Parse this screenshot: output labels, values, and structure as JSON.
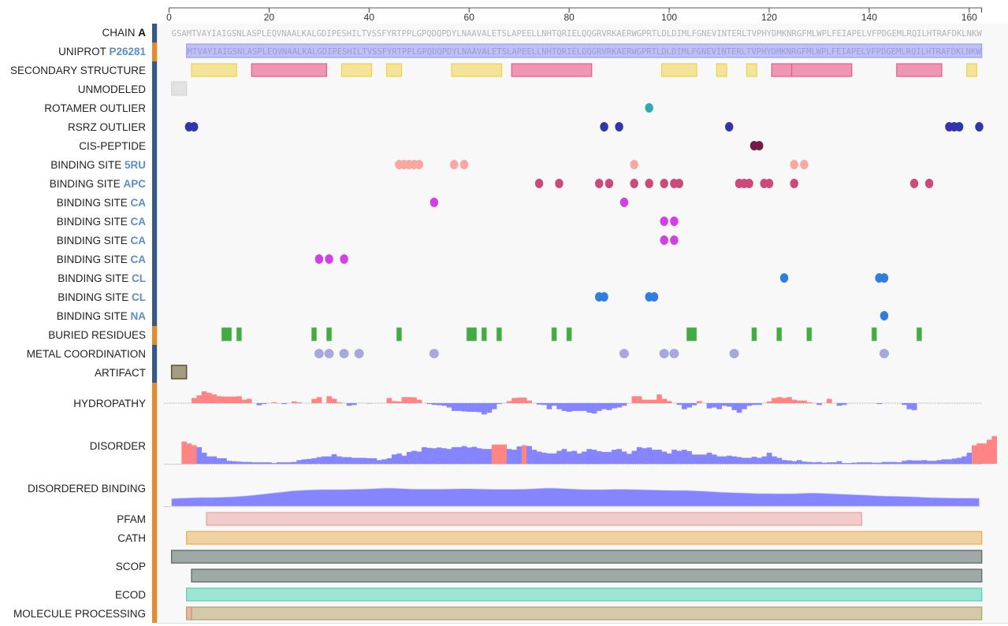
{
  "chart_data": {
    "type": "protein-feature-viewer",
    "axis": {
      "min": 0,
      "max": 162,
      "ticks": [
        0,
        20,
        40,
        60,
        80,
        100,
        120,
        140,
        160
      ]
    },
    "chain": {
      "label": "CHAIN",
      "id": "A",
      "sequence": "GSAMTVAYIAIGSNLASPLEQVNAALKALGDIPESHILTVSSFYRTPPLGPQDQPDYLNAAVALETSLAPEELLNHTQRIELQQGRVRKAERWGPRTLDLDIMLFGNEVINTERLTVPHYDMKNRGFMLWPLFEIAPELVFPDGEMLRQILHTRAFDKLNKW"
    },
    "uniprot": {
      "label": "UNIPROT",
      "id": "P26281",
      "start": 4,
      "end": 162,
      "sequence": "MTVAYIAIGSNLASPLEQVNAALKALGDIPESHILTVSSFYRTPPLGPQDQPDYLNAAVALETSLAPEELLNHTQRIELQQGRVRKAERWGPRTLDLDIMLFGNEVINTERLTVPHYDMKNRGFMLWPLFEIAPELVFPDGEMLRQILHTRAFDKLNKW"
    },
    "secondary_structure": {
      "label": "SECONDARY STRUCTURE",
      "segments": [
        {
          "type": "strand",
          "start": 5,
          "end": 13
        },
        {
          "type": "helix",
          "start": 17,
          "end": 31
        },
        {
          "type": "strand",
          "start": 35,
          "end": 40
        },
        {
          "type": "strand",
          "start": 44,
          "end": 46
        },
        {
          "type": "strand",
          "start": 57,
          "end": 66
        },
        {
          "type": "helix",
          "start": 69,
          "end": 84
        },
        {
          "type": "strand",
          "start": 99,
          "end": 105
        },
        {
          "type": "strand",
          "start": 110,
          "end": 111
        },
        {
          "type": "strand",
          "start": 116,
          "end": 117
        },
        {
          "type": "helix",
          "start": 121,
          "end": 124
        },
        {
          "type": "helix",
          "start": 125,
          "end": 136
        },
        {
          "type": "helix",
          "start": 146,
          "end": 154
        },
        {
          "type": "strand",
          "start": 160,
          "end": 161
        }
      ]
    },
    "unmodeled": {
      "label": "UNMODELED",
      "segments": [
        {
          "start": 1,
          "end": 3
        }
      ]
    },
    "point_tracks": [
      {
        "label": "ROTAMER OUTLIER",
        "color": "#33aaaa",
        "positions": [
          96
        ]
      },
      {
        "label": "RSRZ OUTLIER",
        "color": "#3333aa",
        "positions": [
          4,
          5,
          87,
          90,
          112,
          156,
          157,
          158,
          162
        ]
      },
      {
        "label": "CIS-PEPTIDE",
        "color": "#771a44",
        "positions": [
          117,
          118
        ]
      },
      {
        "label": "BINDING SITE",
        "ligand": "5RU",
        "color": "#f8a8a0",
        "positions": [
          46,
          47,
          48,
          49,
          50,
          57,
          59,
          93,
          125,
          127
        ]
      },
      {
        "label": "BINDING SITE",
        "ligand": "APC",
        "color": "#cc4a7a",
        "positions": [
          74,
          78,
          86,
          88,
          93,
          96,
          99,
          101,
          102,
          114,
          115,
          116,
          119,
          120,
          125,
          149,
          152
        ]
      },
      {
        "label": "BINDING SITE",
        "ligand": "CA",
        "color": "#d43ee8",
        "positions": [
          53,
          91
        ]
      },
      {
        "label": "BINDING SITE",
        "ligand": "CA",
        "color": "#d43ee8",
        "positions": [
          99,
          101
        ]
      },
      {
        "label": "BINDING SITE",
        "ligand": "CA",
        "color": "#d43ee8",
        "positions": [
          99,
          101
        ]
      },
      {
        "label": "BINDING SITE",
        "ligand": "CA",
        "color": "#d43ee8",
        "positions": [
          30,
          32,
          35
        ]
      },
      {
        "label": "BINDING SITE",
        "ligand": "CL",
        "color": "#2f7ee0",
        "positions": [
          123,
          142,
          143
        ]
      },
      {
        "label": "BINDING SITE",
        "ligand": "CL",
        "color": "#2f7ee0",
        "positions": [
          86,
          87,
          96,
          97
        ]
      },
      {
        "label": "BINDING SITE",
        "ligand": "NA",
        "color": "#2f7ee0",
        "positions": [
          143
        ]
      }
    ],
    "buried_residues": {
      "label": "BURIED RESIDUES",
      "color": "#44aa44",
      "segments": [
        [
          11,
          12
        ],
        [
          14,
          14
        ],
        [
          29,
          29
        ],
        [
          32,
          32
        ],
        [
          46,
          46
        ],
        [
          60,
          61
        ],
        [
          63,
          63
        ],
        [
          66,
          66
        ],
        [
          77,
          77
        ],
        [
          80,
          80
        ],
        [
          104,
          105
        ],
        [
          117,
          117
        ],
        [
          122,
          122
        ],
        [
          128,
          128
        ],
        [
          141,
          141
        ],
        [
          150,
          150
        ]
      ]
    },
    "metal_coordination": {
      "label": "METAL COORDINATION",
      "color": "#a8a8dc",
      "positions": [
        30,
        32,
        35,
        38,
        53,
        91,
        99,
        101,
        113,
        143
      ]
    },
    "artifact": {
      "label": "ARTIFACT",
      "segments": [
        {
          "start": 1,
          "end": 3
        }
      ]
    },
    "hydropathy": {
      "label": "HYDROPATHY",
      "range": [
        -1,
        1
      ],
      "values": [
        0,
        0,
        0,
        0,
        0.3,
        0.45,
        0.68,
        0.6,
        0.5,
        0.4,
        0.38,
        0.38,
        0.38,
        0.4,
        0.2,
        0.25,
        0,
        -0.12,
        -0.05,
        0,
        0.05,
        0,
        -0.05,
        0,
        0.1,
        0.05,
        0,
        0,
        0.25,
        0.35,
        0,
        0.4,
        0.25,
        0.05,
        0,
        -0.15,
        -0.1,
        0,
        0,
        -0.02,
        0,
        0,
        0,
        0.3,
        0.12,
        0.1,
        0.35,
        0.35,
        0.33,
        0.2,
        0,
        -0.05,
        -0.1,
        -0.12,
        -0.15,
        -0.25,
        -0.45,
        -0.45,
        -0.48,
        -0.5,
        -0.5,
        -0.52,
        -0.65,
        -0.55,
        -0.35,
        -0.05,
        0,
        0.12,
        0.3,
        0.32,
        0.32,
        0.15,
        0,
        -0.08,
        -0.1,
        -0.35,
        -0.15,
        -0.35,
        -0.45,
        -0.5,
        -0.45,
        -0.45,
        -0.45,
        -0.55,
        -0.6,
        -0.45,
        -0.35,
        -0.4,
        -0.3,
        -0.25,
        -0.15,
        0,
        0.4,
        0.4,
        0.2,
        0.2,
        0.2,
        0.5,
        0.25,
        0.12,
        0,
        -0.1,
        -0.35,
        -0.25,
        -0.12,
        0.12,
        0,
        -0.3,
        -0.25,
        -0.35,
        -0.15,
        -0.2,
        -0.4,
        -0.55,
        -0.35,
        -0.15,
        -0.1,
        -0.1,
        0,
        0.1,
        0.3,
        0.35,
        0.3,
        0.35,
        0.2,
        0.15,
        0.15,
        0.05,
        0,
        -0.1,
        0,
        0.25,
        0,
        -0.15,
        -0.1,
        0,
        0,
        0,
        0,
        0,
        0,
        -0.05,
        0,
        0,
        0,
        0,
        -0.1,
        -0.35,
        -0.4,
        0,
        0,
        0,
        0,
        0,
        0,
        0,
        0,
        0,
        0,
        0,
        0,
        0,
        0,
        0
      ]
    },
    "disorder": {
      "label": "DISORDER",
      "range": [
        0,
        1
      ],
      "threshold": 0.5,
      "values": [
        0,
        0,
        0.6,
        0.55,
        0.5,
        0.45,
        0.3,
        0.2,
        0.2,
        0.15,
        0.15,
        0.08,
        0.07,
        0.06,
        0.05,
        0.05,
        0.04,
        0.04,
        0.04,
        0.04,
        0.02,
        0.04,
        0.04,
        0.04,
        0.05,
        0.1,
        0.12,
        0.13,
        0.15,
        0.18,
        0.2,
        0.2,
        0.26,
        0.2,
        0.18,
        0.18,
        0.16,
        0.16,
        0.16,
        0.15,
        0.15,
        0.1,
        0.12,
        0.15,
        0.25,
        0.28,
        0.22,
        0.32,
        0.35,
        0.33,
        0.45,
        0.43,
        0.42,
        0.44,
        0.42,
        0.4,
        0.45,
        0.45,
        0.48,
        0.44,
        0.46,
        0.42,
        0.4,
        0.4,
        0.52,
        0.52,
        0.52,
        0.4,
        0.38,
        0.47,
        0.5,
        0.48,
        0.38,
        0.33,
        0.3,
        0.28,
        0.28,
        0.35,
        0.4,
        0.33,
        0.35,
        0.28,
        0.33,
        0.4,
        0.38,
        0.34,
        0.32,
        0.32,
        0.38,
        0.4,
        0.33,
        0.27,
        0.35,
        0.45,
        0.42,
        0.44,
        0.38,
        0.38,
        0.33,
        0.28,
        0.38,
        0.35,
        0.38,
        0.34,
        0.25,
        0.25,
        0.25,
        0.3,
        0.25,
        0.2,
        0.2,
        0.22,
        0.2,
        0.18,
        0.16,
        0.16,
        0.19,
        0.16,
        0.2,
        0.3,
        0.2,
        0.16,
        0.1,
        0.09,
        0.07,
        0.1,
        0.06,
        0.05,
        0.04,
        0.05,
        0.03,
        0.04,
        0.04,
        0.07,
        0.02,
        0.02,
        0.03,
        0.04,
        0.04,
        0.04,
        0.03,
        0.03,
        0.05,
        0.05,
        0.05,
        0.04,
        0.08,
        0.1,
        0.09,
        0.09,
        0.1,
        0.08,
        0.08,
        0.1,
        0.12,
        0.12,
        0.14,
        0.16,
        0.2,
        0.3,
        0.5,
        0.55,
        0.55,
        0.65,
        0.75
      ]
    },
    "disordered_binding": {
      "label": "DISORDERED BINDING",
      "range": [
        0,
        1
      ],
      "values": [
        0.35,
        0.37,
        0.39,
        0.4,
        0.4,
        0.41,
        0.43,
        0.46,
        0.5,
        0.55,
        0.6,
        0.65,
        0.7,
        0.73,
        0.75,
        0.76,
        0.76,
        0.76,
        0.77,
        0.78,
        0.8,
        0.82,
        0.82,
        0.8,
        0.78,
        0.78,
        0.78,
        0.78,
        0.79,
        0.8,
        0.79,
        0.78,
        0.77,
        0.77,
        0.77,
        0.78,
        0.8,
        0.82,
        0.82,
        0.8,
        0.78,
        0.76,
        0.76,
        0.76,
        0.77,
        0.77,
        0.76,
        0.75,
        0.74,
        0.73,
        0.72,
        0.72,
        0.7,
        0.68,
        0.65,
        0.63,
        0.61,
        0.6,
        0.58,
        0.58,
        0.57,
        0.57,
        0.58,
        0.6,
        0.6,
        0.58,
        0.56,
        0.54,
        0.52,
        0.5,
        0.48,
        0.46,
        0.45,
        0.44,
        0.42,
        0.4,
        0.39,
        0.38,
        0.37,
        0.37,
        0.36
      ]
    },
    "domains": [
      {
        "label": "PFAM",
        "color": "#f0cdcb",
        "border": "#e8a8a5",
        "segments": [
          {
            "start": 8,
            "end": 138
          }
        ]
      },
      {
        "label": "CATH",
        "color": "#eed2a2",
        "border": "#e6b364",
        "segments": [
          {
            "start": 4,
            "end": 162
          }
        ]
      },
      {
        "label": "SCOP",
        "color": "#9faaa7",
        "border": "#5f6f6c",
        "segments": [
          {
            "start": 1,
            "end": 162
          },
          {
            "start": 5,
            "end": 162
          }
        ]
      },
      {
        "label": "ECOD",
        "color": "#9ee4d4",
        "border": "#5fd2b4",
        "segments": [
          {
            "start": 4,
            "end": 162
          }
        ]
      },
      {
        "label": "MOLECULE PROCESSING",
        "color": "#d4c9a8",
        "border": "#b5a67b",
        "segments": [
          {
            "start": 4,
            "end": 4,
            "color": "#f0b2a2"
          },
          {
            "start": 5,
            "end": 162
          }
        ]
      }
    ]
  },
  "labels": {
    "chain": "CHAIN",
    "chain_id": "A",
    "uniprot": "UNIPROT",
    "uniprot_id": "P26281",
    "secondary_structure": "SECONDARY STRUCTURE",
    "unmodeled": "UNMODELED",
    "rotamer": "ROTAMER OUTLIER",
    "rsrz": "RSRZ OUTLIER",
    "cis": "CIS-PEPTIDE",
    "binding_site": "BINDING SITE",
    "ligands": [
      "5RU",
      "APC",
      "CA",
      "CA",
      "CA",
      "CA",
      "CL",
      "CL",
      "NA"
    ],
    "buried": "BURIED RESIDUES",
    "metal": "METAL COORDINATION",
    "artifact": "ARTIFACT",
    "hydropathy": "HYDROPATHY",
    "disorder": "DISORDER",
    "disordered_binding": "DISORDERED BINDING",
    "pfam": "PFAM",
    "cath": "CATH",
    "scop": "SCOP",
    "ecod": "ECOD",
    "molecule_processing": "MOLECULE PROCESSING"
  },
  "colors": {
    "strand_fill": "#f4e49a",
    "strand_border": "#f0d048",
    "helix_fill": "#ee97b4",
    "helix_border": "#e55a8a",
    "uniprot_fill": "#c0c0f8",
    "uniprot_border": "#9c9cf0",
    "positive": "#ff8585",
    "negative": "#8585ff",
    "side_blue": "#375a84",
    "side_orange": "#e38c2c"
  }
}
